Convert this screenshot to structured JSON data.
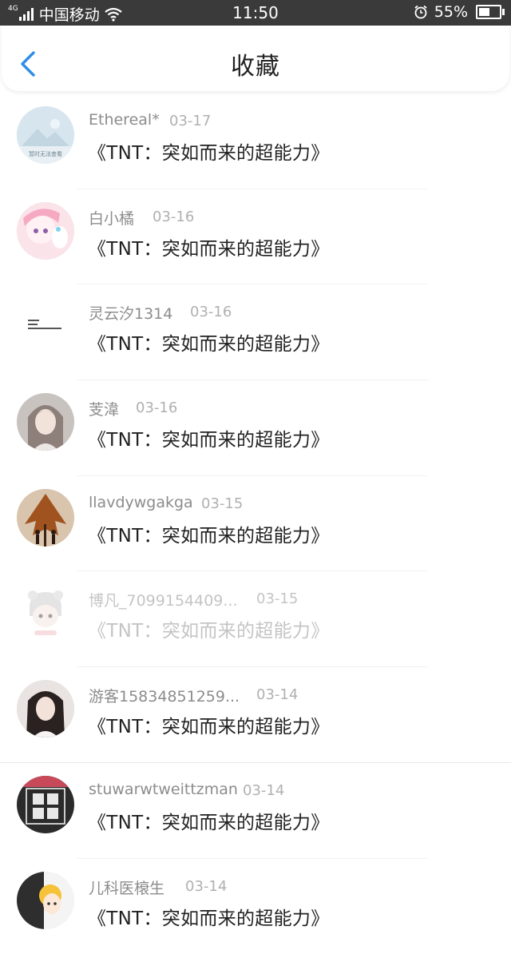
{
  "status_bar": {
    "network": "4G",
    "carrier": "中国移动",
    "time": "11:50",
    "battery": "55%",
    "battery_level": 0.55
  },
  "header": {
    "title": "收藏"
  },
  "items": [
    {
      "user": "Ethereal*",
      "date": "03-17",
      "title": "《TNT：突如而来的超能力》",
      "avatar_text": "暂时无法查看"
    },
    {
      "user": "白小橘",
      "date": "03-16",
      "title": "《TNT：突如而来的超能力》"
    },
    {
      "user": "灵云汐1314",
      "date": "03-16",
      "title": "《TNT：突如而来的超能力》"
    },
    {
      "user": "芰湋",
      "date": "03-16",
      "title": "《TNT：突如而来的超能力》"
    },
    {
      "user": "llavdywgakga",
      "date": "03-15",
      "title": "《TNT：突如而来的超能力》"
    },
    {
      "user": "博凡_7099154409...",
      "date": "03-15",
      "title": "《TNT：突如而来的超能力》"
    },
    {
      "user": "游客15834851259...",
      "date": "03-14",
      "title": "《TNT：突如而来的超能力》"
    },
    {
      "user": "stuwarwtweittzman",
      "date": "03-14",
      "title": "《TNT：突如而来的超能力》"
    },
    {
      "user": "儿科医榱生",
      "date": "03-14",
      "title": "《TNT：突如而来的超能力》"
    }
  ],
  "colors": {
    "accent": "#2e8de6",
    "status_bar_bg": "#3a3a3a",
    "username": "#8c8c8c",
    "date": "#b0b0b0",
    "title_text": "#222222"
  }
}
